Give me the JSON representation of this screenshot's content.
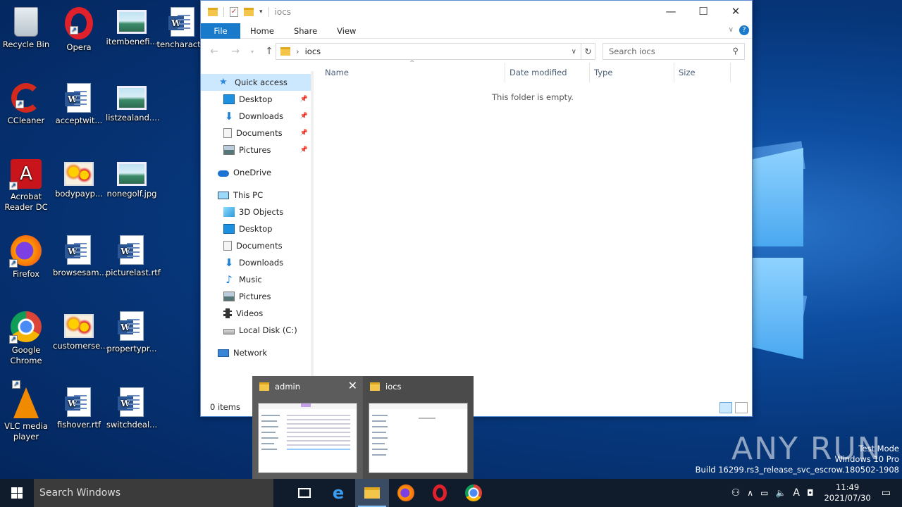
{
  "desktop": {
    "icons": [
      {
        "label": "Recycle Bin"
      },
      {
        "label": "Opera"
      },
      {
        "label": "itembenefi..."
      },
      {
        "label": "tencharact..."
      },
      {
        "label": "CCleaner"
      },
      {
        "label": "acceptwit..."
      },
      {
        "label": "listzealand...."
      },
      {
        "label": "Acrobat Reader DC"
      },
      {
        "label": "bodypayp..."
      },
      {
        "label": "nonegolf.jpg"
      },
      {
        "label": "Firefox"
      },
      {
        "label": "browsesam..."
      },
      {
        "label": "picturelast.rtf"
      },
      {
        "label": "Google Chrome"
      },
      {
        "label": "customerse..."
      },
      {
        "label": "propertypr..."
      },
      {
        "label": "VLC media player"
      },
      {
        "label": "fishover.rtf"
      },
      {
        "label": "switchdeal..."
      }
    ]
  },
  "explorer": {
    "title": "iocs",
    "ribbon_tabs": [
      "File",
      "Home",
      "Share",
      "View"
    ],
    "path": "iocs",
    "search_placeholder": "Search iocs",
    "nav": [
      {
        "label": "Quick access"
      },
      {
        "label": "Desktop"
      },
      {
        "label": "Downloads"
      },
      {
        "label": "Documents"
      },
      {
        "label": "Pictures"
      },
      {
        "label": "OneDrive"
      },
      {
        "label": "This PC"
      },
      {
        "label": "3D Objects"
      },
      {
        "label": "Desktop"
      },
      {
        "label": "Documents"
      },
      {
        "label": "Downloads"
      },
      {
        "label": "Music"
      },
      {
        "label": "Pictures"
      },
      {
        "label": "Videos"
      },
      {
        "label": "Local Disk (C:)"
      },
      {
        "label": "Network"
      }
    ],
    "columns": [
      "Name",
      "Date modified",
      "Type",
      "Size"
    ],
    "empty_message": "This folder is empty.",
    "status": "0 items"
  },
  "thumbnails": [
    {
      "title": "admin"
    },
    {
      "title": "iocs"
    }
  ],
  "taskbar": {
    "search_placeholder": "Search Windows",
    "time": "11:49",
    "date": "2021/07/30"
  },
  "watermark": {
    "line1": "Test Mode",
    "line2": "Windows 10 Pro",
    "line3": "Build 16299.rs3_release_svc_escrow.180502-1908",
    "brand": "ANY RUN"
  },
  "colors": {
    "accent": "#1979ca",
    "selection": "#cce8ff",
    "taskbar": "#101c2c"
  }
}
